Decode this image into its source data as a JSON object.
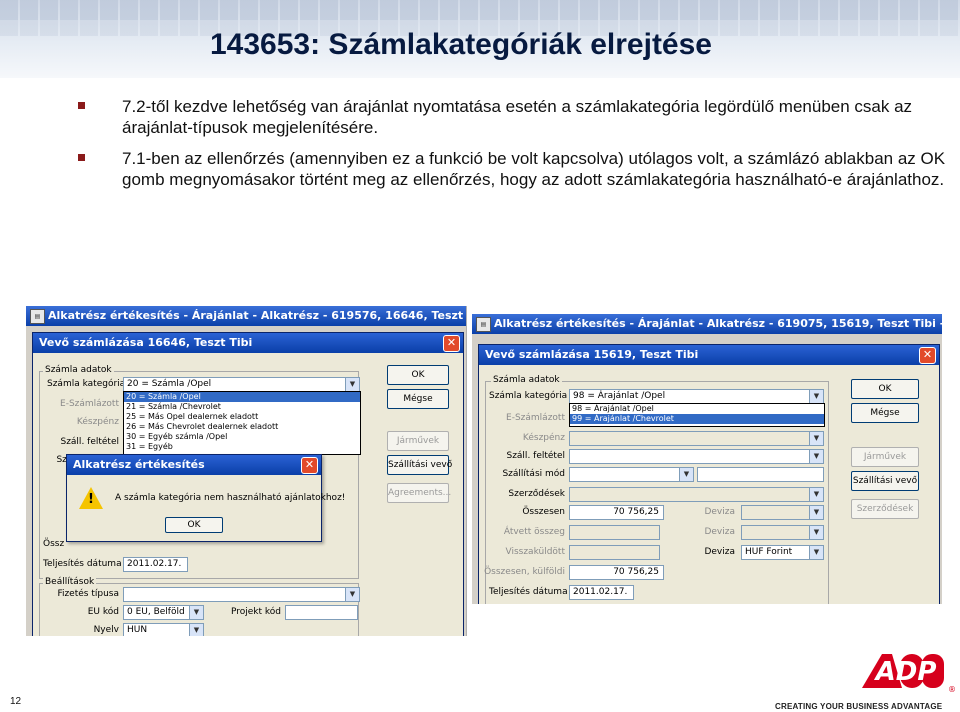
{
  "slide": {
    "title": "143653: Számlakategóriák elrejtése",
    "bullets": [
      "7.2-től kezdve lehetőség van árajánlat nyomtatása esetén a számlakategória legördülő menüben csak az árajánlat-típusok megjelenítésére.",
      "7.1-ben az ellenőrzés (amennyiben ez a funkció be volt kapcsolva) utólagos volt, a számlázó ablakban az OK gomb megnyomásakor történt meg az ellenőrzés, hogy az adott számlakategória használható-e árajánlathoz."
    ],
    "page_number": "12",
    "slogan": "CREATING YOUR BUSINESS ADVANTAGE",
    "brand_color": "#d6001c",
    "logo": "ADP"
  },
  "left": {
    "window_title": "Alkatrész értékesítés - Árajánlat - Alkatrész - 619576, 16646, Teszt Tibi - Training DE",
    "dialog_title": "Vevő számlázása 16646, Teszt Tibi",
    "group_invoice": "Számla adatok",
    "labels": {
      "category": "Számla kategória",
      "e_invoice": "E-Számlázott",
      "cash": "Készpénz",
      "transport_terms": "Száll. feltétel",
      "transport_mode": "Szállítási mód",
      "total": "Össz",
      "due_date": "Teljesítés dátuma"
    },
    "category_value": "20 = Számla /Opel",
    "category_options": [
      "20 = Számla /Opel",
      "21 = Számla /Chevrolet",
      "25 = Más Opel dealernek eladott",
      "26 = Más Chevrolet dealernek eladott",
      "30 = Egyéb számla /Opel",
      "31 = Egyéb"
    ],
    "due_date_value": "2011.02.17.",
    "group_settings": "Beállítások",
    "settings_labels": {
      "payment_type": "Fizetés típusa",
      "eu_code": "EU kód",
      "project_code": "Projekt kód",
      "language": "Nyelv"
    },
    "eu_code_value": "0 EU, Belföld",
    "language_value": "HUN",
    "buttons": {
      "ok": "OK",
      "cancel": "Mégse",
      "vehicles": "Járművek",
      "carrier": "Szállítási vevő",
      "agreements": "Agreements..."
    },
    "alert": {
      "title": "Alkatrész értékesítés",
      "message": "A számla kategória nem használható ajánlatokhoz!",
      "ok": "OK"
    }
  },
  "right": {
    "window_title": "Alkatrész értékesítés - Árajánlat - Alkatrész - 619075, 15619, Teszt Tibi - Training DE",
    "dialog_title": "Vevő számlázása 15619, Teszt Tibi",
    "group_invoice": "Számla adatok",
    "labels": {
      "category": "Számla kategória",
      "e_invoice": "E-Számlázott",
      "cash": "Készpénz",
      "transport_terms": "Száll. feltétel",
      "transport_mode": "Szállítási mód",
      "contracts": "Szerződések",
      "total": "Összesen",
      "change": "Átvett összeg",
      "returned": "Visszaküldött",
      "total_foreign": "Összesen, külföldi",
      "due_date": "Teljesítés dátuma",
      "currency": "Deviza"
    },
    "category_value": "98 = Árajánlat /Opel",
    "category_options": [
      "98 = Árajánlat /Opel",
      "99 = Árajánlat /Chevrolet"
    ],
    "total_value": "70 756,25",
    "total_foreign_value": "70 756,25",
    "currency_value": "HUF Forint",
    "due_date_value": "2011.02.17.",
    "buttons": {
      "ok": "OK",
      "cancel": "Mégse",
      "vehicles": "Járművek",
      "carrier": "Szállítási vevő",
      "contracts": "Szerződések"
    }
  }
}
